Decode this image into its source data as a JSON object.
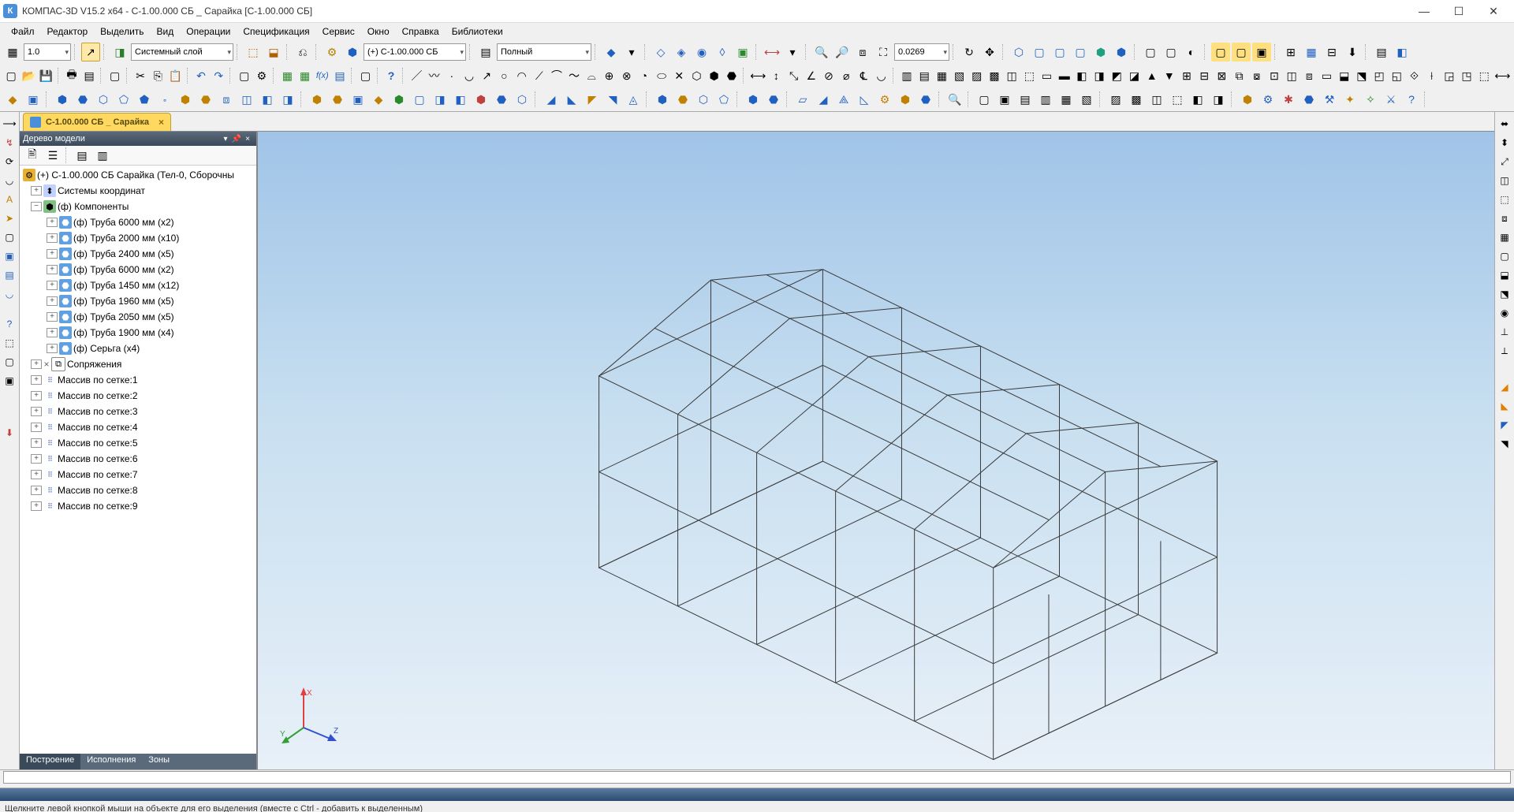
{
  "title": "КОМПАС-3D V15.2  x64 - С-1.00.000 СБ _ Сарайка [С-1.00.000 СБ]",
  "menu": [
    "Файл",
    "Редактор",
    "Выделить",
    "Вид",
    "Операции",
    "Спецификация",
    "Сервис",
    "Окно",
    "Справка",
    "Библиотеки"
  ],
  "tb1": {
    "scale": "1.0",
    "layer": "Системный слой",
    "assy": "(+) С-1.00.000 СБ",
    "detail": "Полный",
    "zoom": "0.0269"
  },
  "doc_tab": {
    "label": "С-1.00.000 СБ _ Сарайка"
  },
  "panel": {
    "title": "Дерево модели"
  },
  "tree": {
    "root": "(+) С-1.00.000 СБ Сарайка (Тел-0, Сборочны",
    "coord": "Системы координат",
    "comp": "(ф) Компоненты",
    "parts": [
      "(ф) Труба 6000 мм (x2)",
      "(ф) Труба 2000 мм (x10)",
      "(ф) Труба 2400 мм (x5)",
      "(ф) Труба 6000 мм (x2)",
      "(ф) Труба 1450 мм (x12)",
      "(ф) Труба 1960 мм (x5)",
      "(ф) Труба 2050 мм (x5)",
      "(ф) Труба 1900 мм (x4)",
      "(ф) Серьга (x4)"
    ],
    "mates": "Сопряжения",
    "arrays": [
      "Массив по сетке:1",
      "Массив по сетке:2",
      "Массив по сетке:3",
      "Массив по сетке:4",
      "Массив по сетке:5",
      "Массив по сетке:6",
      "Массив по сетке:7",
      "Массив по сетке:8",
      "Массив по сетке:9"
    ]
  },
  "panel_tabs": [
    "Построение",
    "Исполнения",
    "Зоны"
  ],
  "status": "Щелкните левой кнопкой мыши на объекте для его выделения (вместе с Ctrl - добавить к выделенным)",
  "axis": {
    "x": "X",
    "y": "Y",
    "z": "Z"
  }
}
